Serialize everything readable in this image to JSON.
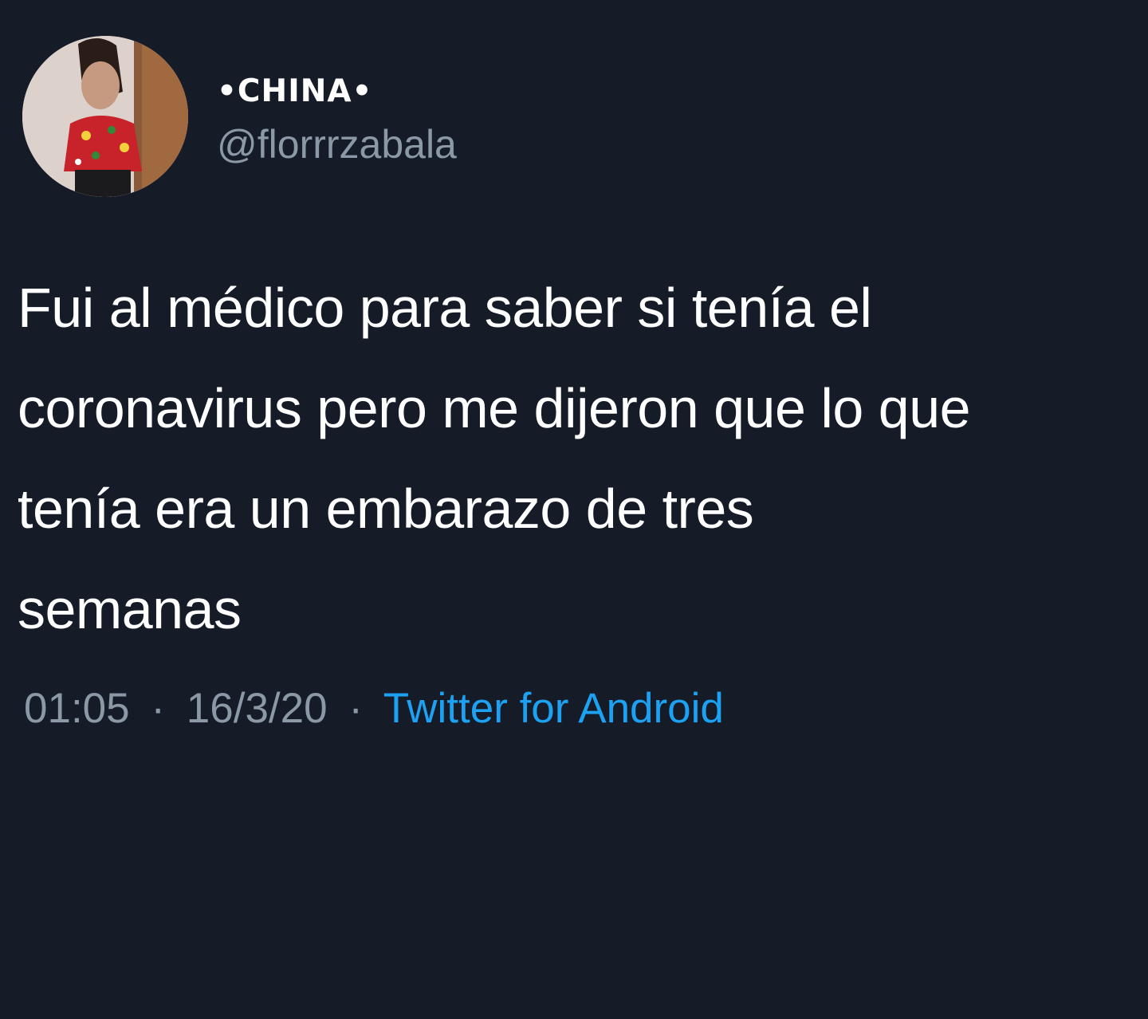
{
  "tweet": {
    "author": {
      "display_name": "•CHINA•",
      "handle": "@florrrzabala"
    },
    "text": "Fui al médico para saber si tenía el\ncoronavirus pero me dijeron que lo que\ntenía era un embarazo de tres\nsemanas",
    "meta": {
      "time": "01:05",
      "date": "16/3/20",
      "separator": "·",
      "source": "Twitter for Android"
    }
  },
  "colors": {
    "background": "#151c28",
    "text_primary": "#ffffff",
    "text_secondary": "#8b98a5",
    "link": "#1da1f2"
  }
}
